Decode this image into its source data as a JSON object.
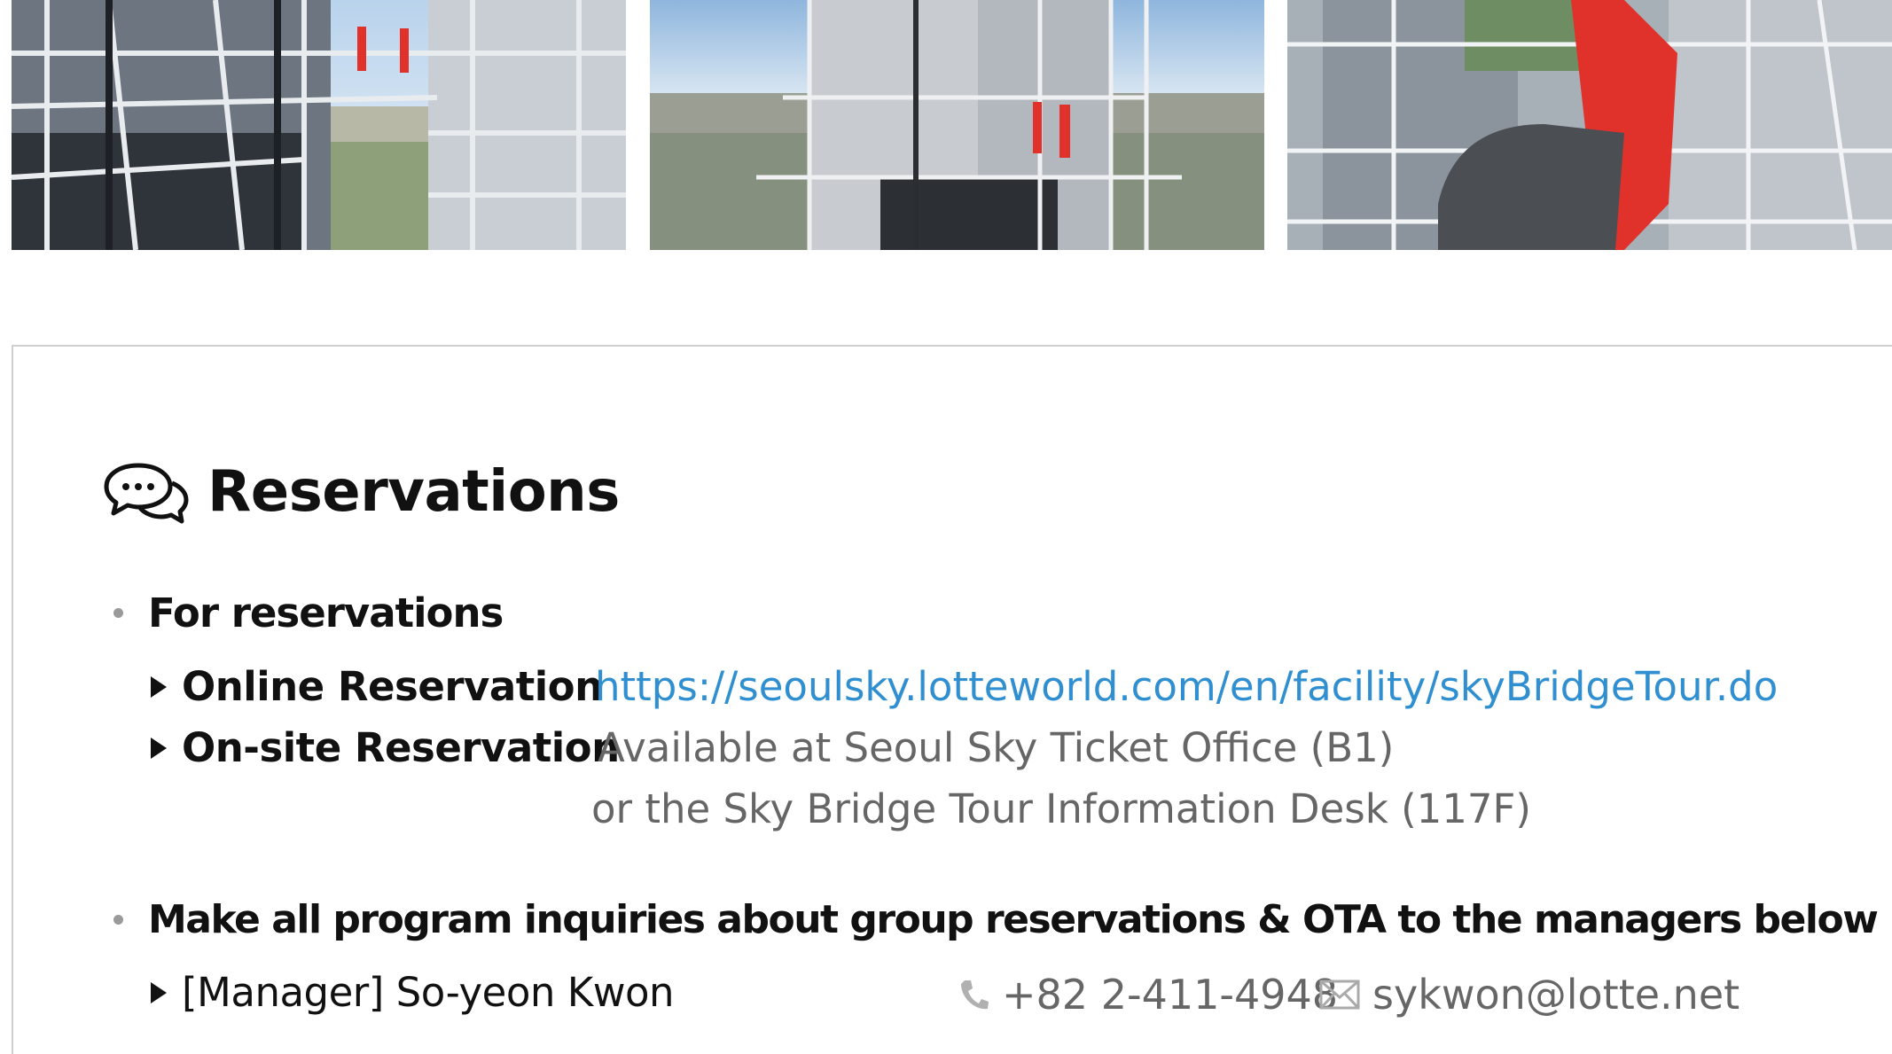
{
  "photos": [
    {
      "name": "sky-bridge-walkers-distance"
    },
    {
      "name": "sky-bridge-walkers-tower"
    },
    {
      "name": "sky-bridge-walker-looking-down"
    }
  ],
  "section": {
    "title": "Reservations",
    "icon": "chat-bubbles-icon"
  },
  "reservations": {
    "heading": "For reservations",
    "online": {
      "label": "Online Reservation",
      "url": "https://seoulsky.lotteworld.com/en/facility/skyBridgeTour.do"
    },
    "onsite": {
      "label": "On-site Reservation",
      "line1": "Available at Seoul Sky Ticket Office (B1)",
      "line2": "or the Sky Bridge Tour Information Desk (117F)"
    }
  },
  "inquiries": {
    "heading": "Make all program inquiries about group reservations & OTA to the managers below",
    "manager": {
      "label": "[Manager] So-yeon Kwon",
      "phone": "+82 2-411-4948",
      "email": "sykwon@lotte.net"
    }
  },
  "colors": {
    "link": "#2f8fd0",
    "muted": "#666666",
    "accent_suit": "#e0322b"
  }
}
